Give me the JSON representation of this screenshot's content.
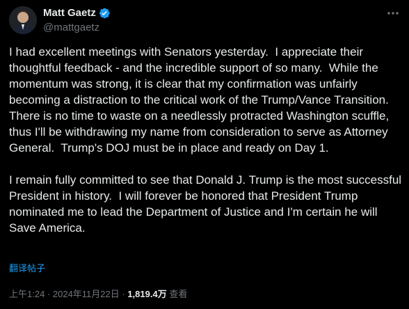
{
  "author": {
    "display_name": "Matt Gaetz",
    "handle": "@mattgaetz"
  },
  "post": {
    "paragraph_1": "I had excellent meetings with Senators yesterday.  I appreciate their thoughtful feedback - and the incredible support of so many.  While the momentum was strong, it is clear that my confirmation was unfairly becoming a distraction to the critical work of the Trump/Vance Transition.  There is no time to waste on a needlessly protracted Washington scuffle, thus I'll be withdrawing my name from consideration to serve as Attorney General.  Trump's DOJ must be in place and ready on Day 1.",
    "paragraph_2": "I remain fully committed to see that Donald J. Trump is the most successful President in history.  I will forever be honored that President Trump nominated me to lead the Department of Justice and I'm certain he will Save America.",
    "translate_label": "翻译帖子"
  },
  "meta": {
    "time": "上午1:24",
    "separator": " · ",
    "date": "2024年11月22日",
    "views_count": "1,819.4万",
    "views_label": "查看"
  },
  "colors": {
    "background": "#000000",
    "text": "#e7e9ea",
    "secondary": "#71767b",
    "accent": "#1d9bf0"
  },
  "icons": {
    "verified": "verified-badge-icon",
    "more": "more-options-icon"
  }
}
